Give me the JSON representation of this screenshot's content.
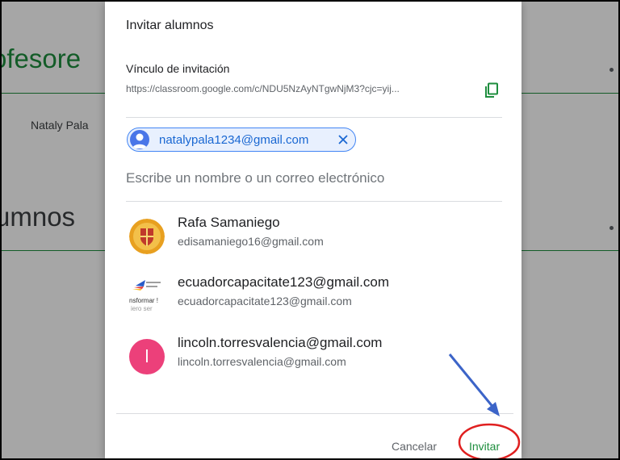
{
  "background": {
    "teachers_heading": "ofesore",
    "teacher_name": "Nataly Pala",
    "students_heading": "umnos"
  },
  "dialog": {
    "title": "Invitar alumnos",
    "link_label": "Vínculo de invitación",
    "link_url": "https://classroom.google.com/c/NDU5NzAyNTgwNjM3?cjc=yij...",
    "copy_icon": "copy-icon",
    "selected_chip": "natalypala1234@gmail.com",
    "input_placeholder": "Escribe un nombre o un correo electrónico",
    "suggestions": [
      {
        "name": "Rafa Samaniego",
        "email": "edisamaniego16@gmail.com",
        "avatar": "crest-logo"
      },
      {
        "name": "ecuadorcapacitate123@gmail.com",
        "email": "ecuadorcapacitate123@gmail.com",
        "avatar": "ministry-logo",
        "avatar_text_1": "nsformar !",
        "avatar_text_2": "iero ser"
      },
      {
        "name": "lincoln.torresvalencia@gmail.com",
        "email": "lincoln.torresvalencia@gmail.com",
        "avatar": "letter",
        "initial": "l"
      }
    ],
    "cancel_label": "Cancelar",
    "invite_label": "Invitar"
  },
  "colors": {
    "accent_green": "#1e8e3e",
    "chip_blue": "#1967d2",
    "annotation_red": "#e02020",
    "annotation_arrow": "#3c64c8",
    "lincoln_avatar": "#ec407a"
  }
}
